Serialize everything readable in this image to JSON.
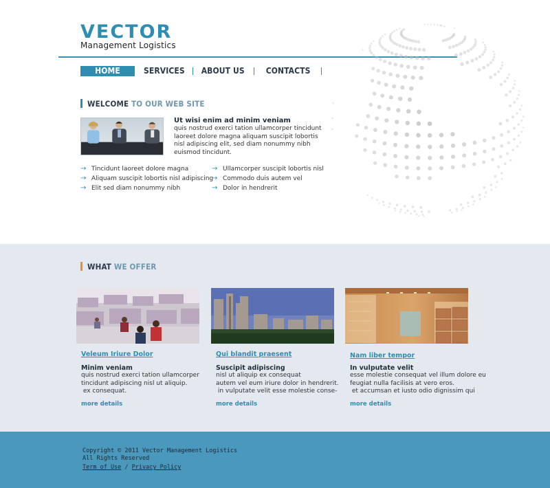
{
  "logo": {
    "word": "VECTOR",
    "subtitle": "Management Logistics"
  },
  "nav": [
    {
      "label": "HOME"
    },
    {
      "label": "SERVICES"
    },
    {
      "label": "ABOUT US"
    },
    {
      "label": "CONTACTS"
    }
  ],
  "welcome": {
    "title_dark": "WELCOME",
    "title_blue": "TO OUR WEB SITE",
    "heading": "Ut wisi enim ad minim veniam",
    "body": "quis nostrud exerci tation ullamcorper tincidunt laoreet dolore magna aliquam suscipit lobortis nisl adipiscing elit, sed diam nonummy nibh euismod tincidunt.",
    "bullets_left": [
      "Tincidunt laoreet dolore magna",
      "Aliquam suscipit lobortis nisl adipiscing",
      "Elit sed diam nonummy nibh"
    ],
    "bullets_right": [
      "Ullamcorper suscipit lobortis nisl",
      "Commodo duis autem vel",
      "Dolor in hendrerit"
    ]
  },
  "offer": {
    "title_dark": "WHAT",
    "title_blue": "WE OFFER",
    "cards": [
      {
        "link": "Veleum Iriure Dolor",
        "heading": "Minim veniam",
        "body": "quis nostrud exerci tation ullamcorper\ntincidunt adipiscing nisl ut aliquip.\n ex consequat.",
        "more": "more details"
      },
      {
        "link": "Qui blandit praesent",
        "heading": "Suscipit adipiscing",
        "body": "nisl ut aliquip ex consequat\nautem vel eum iriure dolor in hendrerit.\n in vulputate velit esse molestie conse-",
        "more": "more details"
      },
      {
        "link": "Nam liber tempor",
        "heading": "In vulputate velit",
        "body": "esse molestie consequat vel illum dolore eu\nfeugiat nulla facilisis at vero eros.\n et accumsan et iusto odio dignissim qui",
        "more": "more details"
      }
    ]
  },
  "footer": {
    "copyright": "Copyright © 2011 Vector Management Logistics",
    "rights": "All Rights Reserved",
    "terms": "Term of Use",
    "separator": "/",
    "privacy": "Privacy Policy"
  },
  "colors": {
    "brand": "#2f8db1",
    "offer_accent": "#f08a2e",
    "band": "#e4e9ef",
    "footer": "#4a98bb"
  },
  "icons": {
    "bullet": "arrow-right-icon"
  }
}
